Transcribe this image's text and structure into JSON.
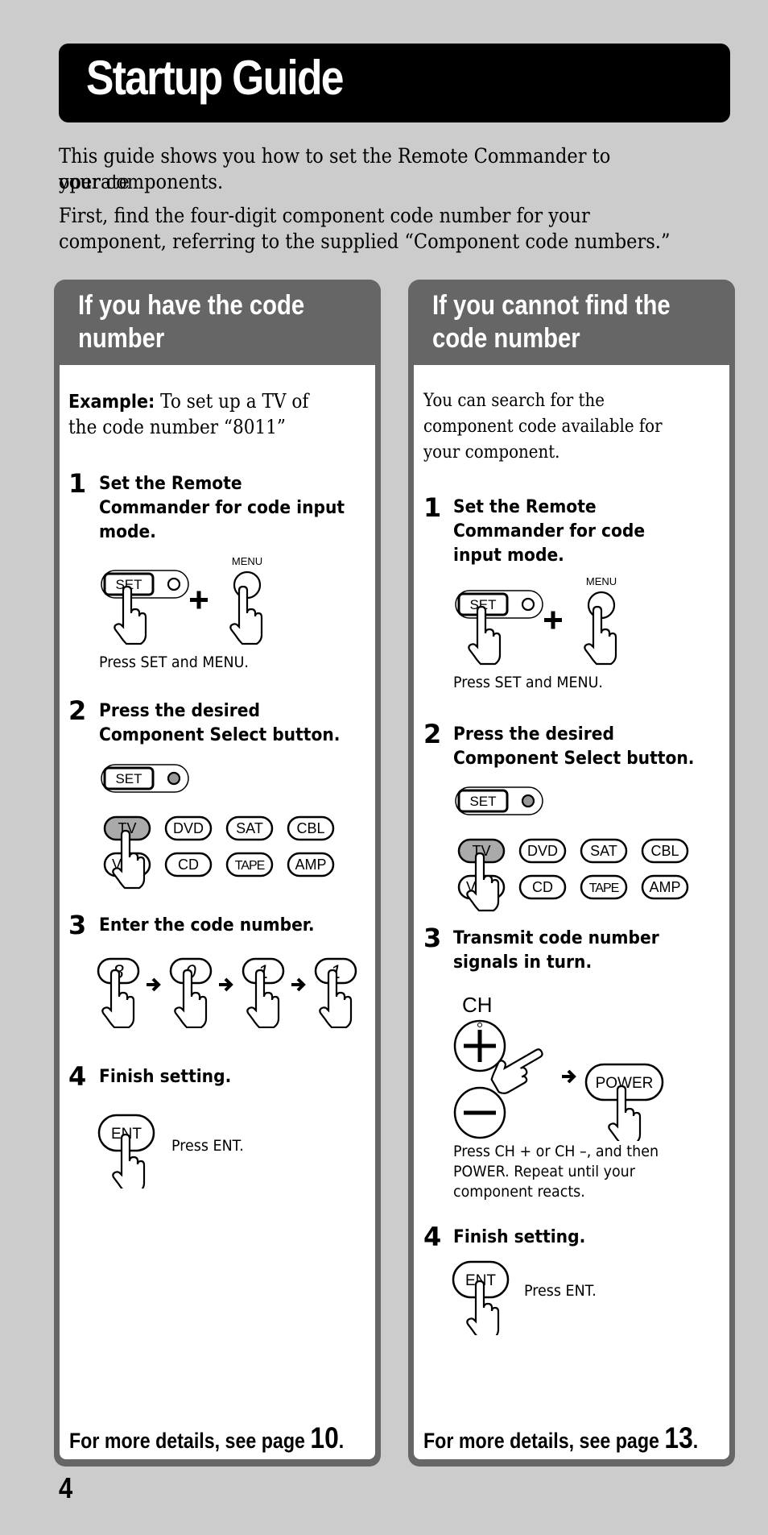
{
  "header": {
    "title": "Startup Guide"
  },
  "intro": {
    "lines": [
      "This guide shows you how to set the Remote Commander to operate",
      "your components.",
      "First, find the four-digit component code number for your",
      "component, referring to the supplied “Component code numbers.”"
    ]
  },
  "left_panel": {
    "title_lines": [
      "If you have the code",
      "number"
    ],
    "example_label": "Example:",
    "example_text_1": " To set up a TV of",
    "example_text_2": "the code number “8011”",
    "steps": [
      {
        "num": "1",
        "lines": [
          "Set the Remote",
          "Commander for code input",
          "mode."
        ],
        "caption": "Press SET and MENU."
      },
      {
        "num": "2",
        "lines": [
          "Press the desired",
          "Component Select button."
        ]
      },
      {
        "num": "3",
        "lines": [
          "Enter the code number."
        ]
      },
      {
        "num": "4",
        "lines": [
          "Finish setting."
        ],
        "caption": "Press ENT."
      }
    ],
    "digits": [
      "8",
      "0",
      "1",
      "1"
    ],
    "footer_text": "For more details, see page ",
    "footer_page": "10",
    "footer_end": "."
  },
  "right_panel": {
    "title_lines": [
      "If you cannot find the",
      "code number"
    ],
    "intro_lines": [
      "You can search for the",
      "component code available for",
      "your component."
    ],
    "steps": [
      {
        "num": "1",
        "lines": [
          "Set the Remote",
          "Commander for code",
          "input mode."
        ],
        "caption": "Press SET and MENU."
      },
      {
        "num": "2",
        "lines": [
          "Press the desired",
          "Component Select button."
        ]
      },
      {
        "num": "3",
        "lines": [
          "Transmit code number",
          "signals in turn."
        ],
        "caption_lines": [
          "Press CH + or CH –, and then",
          "POWER. Repeat until your",
          "component reacts."
        ]
      },
      {
        "num": "4",
        "lines": [
          "Finish setting."
        ],
        "caption": "Press ENT."
      }
    ],
    "footer_text": "For more details, see page ",
    "footer_page": "13",
    "footer_end": "."
  },
  "remote": {
    "set_label": "SET",
    "menu_label": "MENU",
    "ent_label": "ENT",
    "ch_label": "CH",
    "power_label": "POWER",
    "component_buttons_row1": [
      "TV",
      "DVD",
      "SAT",
      "CBL"
    ],
    "component_buttons_row2": [
      "VCR",
      "CD",
      "TAPE",
      "AMP"
    ],
    "selected_component": "TV"
  },
  "page_number": "4",
  "colors": {
    "background": "#cccccc",
    "panel_frame": "#666666",
    "title_bar": "#000000",
    "selected_button": "#aaaaaa"
  }
}
